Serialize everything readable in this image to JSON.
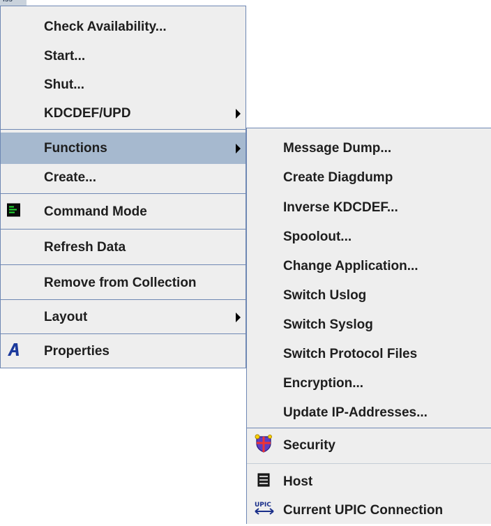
{
  "window_stub_label": "iss",
  "main_menu": {
    "check_availability": "Check Availability...",
    "start": "Start...",
    "shut": "Shut...",
    "kdcdef_upd": "KDCDEF/UPD",
    "functions": "Functions",
    "create": "Create...",
    "command_mode": "Command Mode",
    "refresh_data": "Refresh Data",
    "remove_from_collection": "Remove from Collection",
    "layout": "Layout",
    "properties": "Properties"
  },
  "functions_submenu": {
    "message_dump": "Message Dump...",
    "create_diagdump": "Create Diagdump",
    "inverse_kdcdef": "Inverse KDCDEF...",
    "spoolout": "Spoolout...",
    "change_application": "Change Application...",
    "switch_uslog": "Switch Uslog",
    "switch_syslog": "Switch Syslog",
    "switch_protocol_files": "Switch Protocol Files",
    "encryption": "Encryption...",
    "update_ip_addresses": "Update IP-Addresses...",
    "security": "Security",
    "host": "Host",
    "current_upic_connection": "Current UPIC Connection"
  },
  "icons": {
    "command_mode": "terminal-icon",
    "properties": "properties-a-icon",
    "security": "shield-icon",
    "host": "host-icon",
    "upic": "upic-connection-icon"
  },
  "colors": {
    "menu_background": "#eeeeee",
    "selected_background": "#a6b9cf",
    "border": "#6e87b3"
  }
}
